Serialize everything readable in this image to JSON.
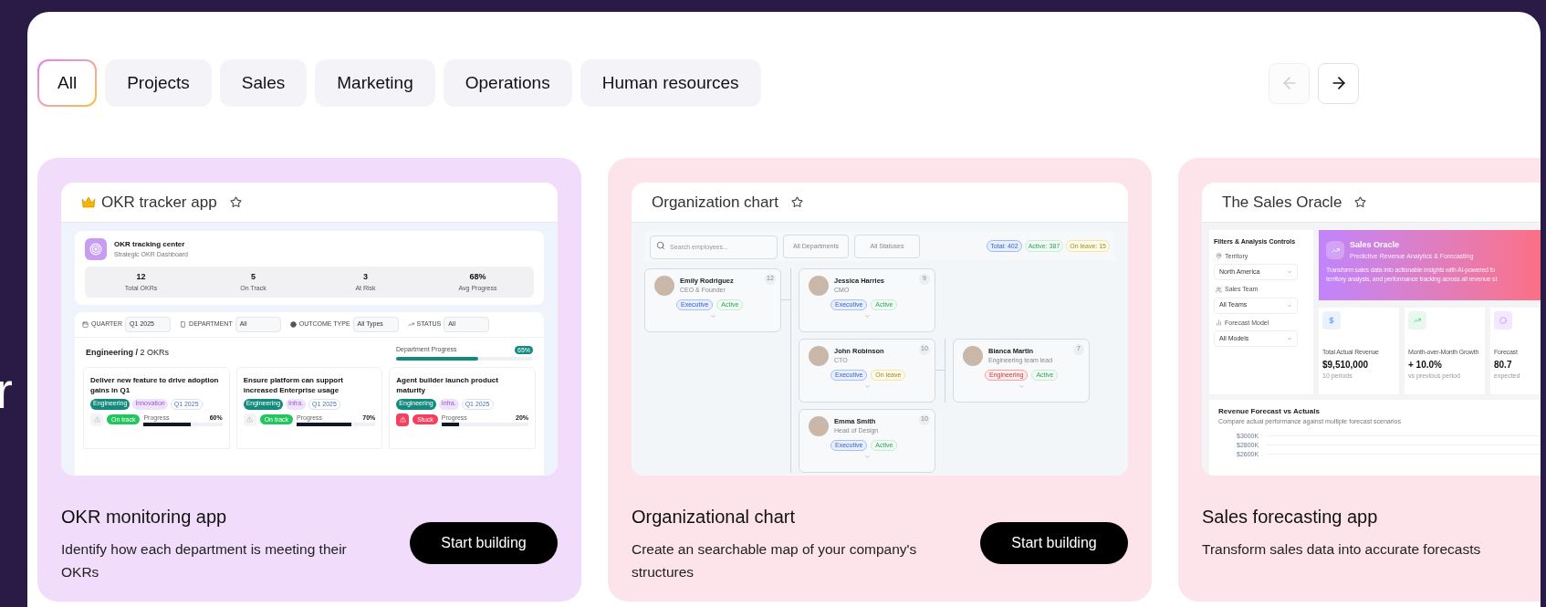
{
  "side_text": "r",
  "tabs": [
    {
      "label": "All",
      "selected": true
    },
    {
      "label": "Projects",
      "selected": false
    },
    {
      "label": "Sales",
      "selected": false
    },
    {
      "label": "Marketing",
      "selected": false
    },
    {
      "label": "Operations",
      "selected": false
    },
    {
      "label": "Human resources",
      "selected": false
    }
  ],
  "nav": [
    {
      "kind": "prev",
      "disabled": true
    },
    {
      "kind": "next",
      "disabled": false
    }
  ],
  "cards": [
    {
      "kind": "okr",
      "color": "#f1ddfb",
      "title": "OKR monitoring app",
      "description": "Identify how each department is meeting their OKRs",
      "button": "Start building",
      "preview": {
        "title": "OKR tracker app",
        "crown": true,
        "header": {
          "title": "OKR tracking center",
          "subtitle": "Strategic OKR Dashboard"
        },
        "stats": [
          {
            "value": "12",
            "label": "Total OKRs"
          },
          {
            "value": "5",
            "label": "On Track"
          },
          {
            "value": "3",
            "label": "At Risk"
          },
          {
            "value": "68%",
            "label": "Avg Progress"
          }
        ],
        "filters": [
          {
            "kind": "calendar",
            "label": "QUARTER",
            "value": "Q1 2025"
          },
          {
            "kind": "device",
            "label": "DEPARTMENT",
            "value": "All"
          },
          {
            "kind": "dot",
            "label": "OUTCOME TYPE",
            "value": "All Types"
          },
          {
            "kind": "trend",
            "label": "STATUS",
            "value": "All"
          }
        ],
        "group": {
          "title": "**Engineering /** 2 OKRs",
          "progress_label": "Department Progress",
          "level": 0.6,
          "badge": "65%"
        },
        "okrs": [
          {
            "title": "Deliver new feature to drive adoption gains in Q1",
            "tags": [
              {
                "kind": "department",
                "label": "Engineering"
              },
              {
                "kind": "category",
                "label": "Innovation"
              },
              {
                "kind": "quarter",
                "label": "Q1 2025"
              }
            ],
            "status": {
              "kind": "on_track",
              "label": "On track"
            },
            "progress_label": "Progress",
            "progress": "60%",
            "level": 0.6
          },
          {
            "title": "Ensure platform can support increased Enterprise usage",
            "tags": [
              {
                "kind": "department",
                "label": "Engineering"
              },
              {
                "kind": "category",
                "label": "Infra."
              },
              {
                "kind": "quarter",
                "label": "Q1 2025"
              }
            ],
            "status": {
              "kind": "on_track",
              "label": "On track"
            },
            "progress_label": "Progress",
            "progress": "70%",
            "level": 0.7
          },
          {
            "title": "Agent builder launch product maturity",
            "tags": [
              {
                "kind": "department",
                "label": "Engineering"
              },
              {
                "kind": "category",
                "label": "Infra."
              },
              {
                "kind": "quarter",
                "label": "Q1 2025"
              }
            ],
            "status": {
              "kind": "stuck",
              "label": "Stuck"
            },
            "progress_label": "Progress",
            "progress": "20%",
            "level": 0.2
          }
        ]
      }
    },
    {
      "kind": "org",
      "color": "#fde3ea",
      "title": "Organizational chart",
      "description": "Create an searchable map of your company's structures",
      "button": "Start building",
      "preview": {
        "title": "Organization chart",
        "crown": false,
        "search": {
          "placeholder": "Search employees..."
        },
        "filters": [
          "All Departments",
          "All Statuses"
        ],
        "counts": [
          {
            "kind": "total",
            "label": "Total: 402"
          },
          {
            "kind": "active",
            "label": "Active: 387"
          },
          {
            "kind": "leave",
            "label": "On leave: 15"
          }
        ],
        "tree": [
          {
            "name": "Emily Rodriguez",
            "role": "CEO & Founder",
            "count": "12",
            "tags": [
              {
                "kind": "executive",
                "label": "Executive"
              },
              {
                "kind": "active",
                "label": "Active"
              }
            ],
            "children": [
              {
                "name": "Jessica Harries",
                "role": "CMO",
                "count": "9",
                "tags": [
                  {
                    "kind": "executive",
                    "label": "Executive"
                  },
                  {
                    "kind": "active",
                    "label": "Active"
                  }
                ]
              },
              {
                "name": "John Robinson",
                "role": "CTO",
                "count": "10",
                "tags": [
                  {
                    "kind": "executive",
                    "label": "Executive"
                  },
                  {
                    "kind": "leave",
                    "label": "On leave"
                  }
                ],
                "children": [
                  {
                    "name": "Bianca Martin",
                    "role": "Engineering team lead",
                    "count": "7",
                    "tags": [
                      {
                        "kind": "engineering",
                        "label": "Engineering"
                      },
                      {
                        "kind": "active",
                        "label": "Active"
                      }
                    ]
                  }
                ]
              },
              {
                "name": "Emma Smith",
                "role": "Head of Design",
                "count": "10",
                "tags": [
                  {
                    "kind": "executive",
                    "label": "Executive"
                  },
                  {
                    "kind": "active",
                    "label": "Active"
                  }
                ]
              }
            ]
          }
        ]
      }
    },
    {
      "kind": "sales",
      "color": "#fde3ea",
      "title": "Sales forecasting app",
      "description": "Transform sales data into accurate forecasts",
      "preview": {
        "title": "The Sales Oracle",
        "crown": false,
        "filters_title": "Filters & Analysis Controls",
        "fields": [
          {
            "kind": "location",
            "label": "Territory",
            "value": "North America"
          },
          {
            "kind": "team",
            "label": "Sales Team",
            "value": "All Teams"
          },
          {
            "kind": "model",
            "label": "Forecast Model",
            "value": "All Models"
          }
        ],
        "hero": {
          "title": "Sales Oracle",
          "subtitle": "Predictive Revenue Analytics & Forecasting",
          "lines": [
            "Transform sales data into actionable insights with AI-powered fo",
            "territory analysis, and performance tracking across all revenue st"
          ]
        },
        "metrics": [
          {
            "kind": "revenue",
            "label": "Total Actual Revenue",
            "value": "$9,510,000",
            "note": "10 periods"
          },
          {
            "kind": "growth",
            "label": "Month-over-Month Growth",
            "value": "+ 10.0%",
            "note": "vs previous period"
          },
          {
            "kind": "forecast",
            "label": "Forecast",
            "value": "80.7",
            "note": "expected"
          }
        ],
        "chart": {
          "title": "Revenue Forecast vs Actuals",
          "subtitle": "Compare actual performance against multiple forecast scenarios",
          "axis_labels": [
            "$3000K",
            "$2800K",
            "$2600K"
          ]
        }
      }
    }
  ]
}
